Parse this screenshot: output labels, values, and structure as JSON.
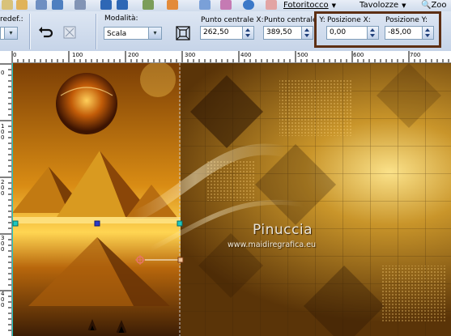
{
  "menu": {
    "fotoritocco": "Fotoritocco",
    "tavolozze": "Tavolozze",
    "zoom": "Zoo"
  },
  "options": {
    "preset_partial": "redef.:",
    "mode_label": "Modalità:",
    "mode_value": "Scala",
    "center_x_label": "Punto centrale X:",
    "center_x_value": "262,50",
    "center_y_label": "Punto centrale Y:",
    "center_y_value": "389,50",
    "pos_x_label": "Posizione X:",
    "pos_x_value": "0,00",
    "pos_y_label": "Posizione Y:",
    "pos_y_value": "-85,00"
  },
  "ruler": {
    "h_ticks": [
      "0",
      "100",
      "200",
      "300",
      "400",
      "500",
      "600",
      "700"
    ],
    "v_ticks": [
      "0",
      "1\n0\n0",
      "2\n0\n0",
      "3\n0\n0",
      "4\n0\n0"
    ]
  },
  "artwork": {
    "watermark_name": "Pinuccia",
    "watermark_url": "www.maidiregrafica.eu"
  },
  "colors": {
    "highlight_border": "#5d2f14",
    "toolbar_bg": "#c6d4e8",
    "pick_node": "#e8746a"
  }
}
